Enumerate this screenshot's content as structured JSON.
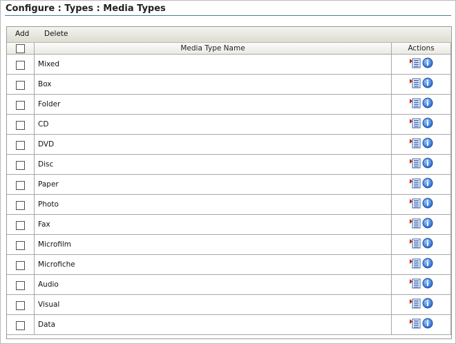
{
  "header": {
    "title": "Configure : Types : Media Types"
  },
  "toolbar": {
    "add_label": "Add",
    "delete_label": "Delete"
  },
  "table": {
    "columns": {
      "name": "Media Type Name",
      "actions": "Actions"
    },
    "rows": [
      {
        "name": "Mixed"
      },
      {
        "name": "Box"
      },
      {
        "name": "Folder"
      },
      {
        "name": "CD"
      },
      {
        "name": "DVD"
      },
      {
        "name": "Disc"
      },
      {
        "name": "Paper"
      },
      {
        "name": "Photo"
      },
      {
        "name": "Fax"
      },
      {
        "name": "Microfilm"
      },
      {
        "name": "Microfiche"
      },
      {
        "name": "Audio"
      },
      {
        "name": "Visual"
      },
      {
        "name": "Data"
      }
    ],
    "row_actions": [
      "list-details-icon",
      "info-icon"
    ]
  },
  "colors": {
    "title_rule": "#4a7b9a",
    "info_blue": "#1f63c8",
    "list_red": "#c0201b"
  }
}
